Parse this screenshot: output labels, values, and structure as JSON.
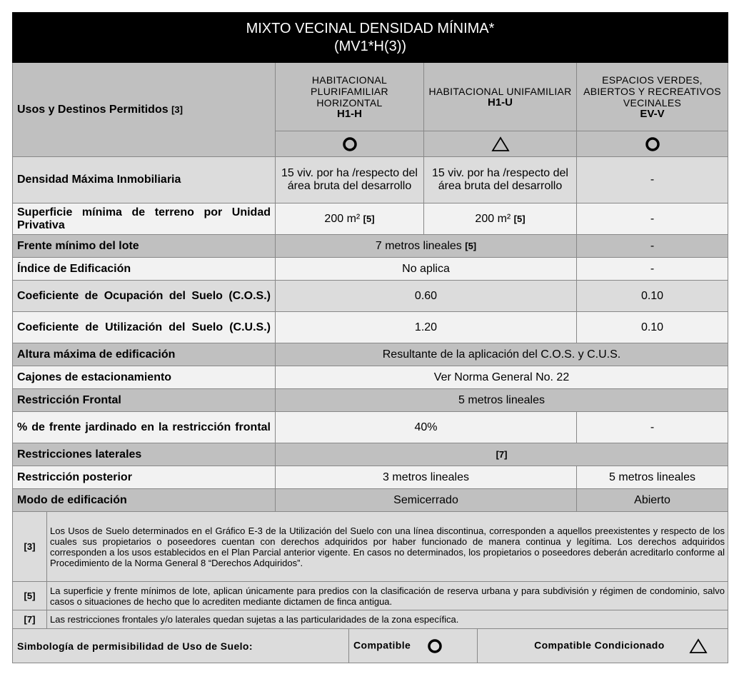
{
  "title": {
    "line1": "MIXTO VECINAL DENSIDAD MÍNIMA*",
    "line2": "(MV1*H(3))"
  },
  "uses": {
    "label": "Usos y Destinos Permitidos",
    "ref": "[3]",
    "columns": [
      {
        "desc": "HABITACIONAL PLURIFAMILIAR HORIZONTAL",
        "code": "H1-H",
        "symbol": "circle-icon"
      },
      {
        "desc": "HABITACIONAL UNIFAMILIAR",
        "code": "H1-U",
        "symbol": "triangle-icon"
      },
      {
        "desc": "ESPACIOS VERDES, ABIERTOS Y RECREATIVOS VECINALES",
        "code": "EV-V",
        "symbol": "circle-icon"
      }
    ]
  },
  "rows": {
    "densidad": {
      "label": "Densidad Máxima Inmobiliaria",
      "c1": "15 viv. por ha /respecto del área bruta del desarrollo",
      "c2": "15 viv. por ha /respecto del área bruta del desarrollo",
      "c3": "-"
    },
    "superficie": {
      "label": "Superficie mínima de terreno por Unidad Privativa",
      "c1": "200 m²",
      "c1_ref": "[5]",
      "c2": "200 m²",
      "c2_ref": "[5]",
      "c3": "-"
    },
    "frente": {
      "label": "Frente mínimo del lote",
      "c12": "7 metros lineales",
      "c12_ref": "[5]",
      "c3": "-"
    },
    "indice": {
      "label": "Índice de Edificación",
      "c12": "No aplica",
      "c3": "-"
    },
    "cos": {
      "label": "Coeficiente de Ocupación del Suelo (C.O.S.)",
      "c12": "0.60",
      "c3": "0.10"
    },
    "cus": {
      "label": "Coeficiente de Utilización del Suelo (C.U.S.)",
      "c12": "1.20",
      "c3": "0.10"
    },
    "altura": {
      "label": "Altura máxima de edificación",
      "c123": "Resultante de la aplicación del C.O.S. y C.U.S."
    },
    "cajones": {
      "label": "Cajones de estacionamiento",
      "c123": "Ver Norma General No. 22"
    },
    "restr_frontal": {
      "label": "Restricción Frontal",
      "c123": "5 metros lineales"
    },
    "jardinado": {
      "label": "% de frente jardinado en la restricción frontal",
      "c12": "40%",
      "c3": "-"
    },
    "laterales": {
      "label": "Restricciones laterales",
      "c123": "[7]"
    },
    "posterior": {
      "label": "Restricción posterior",
      "c12": "3 metros lineales",
      "c3": "5 metros lineales"
    },
    "modo": {
      "label": "Modo de edificación",
      "c12": "Semicerrado",
      "c3": "Abierto"
    }
  },
  "notes": [
    {
      "ref": "[3]",
      "text": "Los Usos de Suelo determinados en el Gráfico E-3 de la Utilización del Suelo con una línea discontinua, corresponden a aquellos preexistentes y respecto de los cuales sus propietarios o poseedores cuentan con derechos adquiridos por haber funcionado de manera continua y legítima. Los derechos adquiridos corresponden a los usos establecidos en el Plan Parcial anterior vigente. En casos no determinados, los propietarios o poseedores deberán acreditarlo conforme al Procedimiento de la Norma General 8 “Derechos Adquiridos”."
    },
    {
      "ref": "[5]",
      "text": "La superficie y frente mínimos de lote, aplican únicamente para predios con la clasificación de reserva urbana y para subdivisión y régimen de condominio, salvo casos o situaciones de hecho que lo acrediten mediante dictamen de finca antigua."
    },
    {
      "ref": "[7]",
      "text": "Las restricciones frontales y/o laterales quedan sujetas a las particularidades de la zona específica."
    }
  ],
  "legend": {
    "label": "Simbología de permisibilidad de Uso de Suelo:",
    "compatible": "Compatible",
    "conditional": "Compatible Condicionado"
  }
}
